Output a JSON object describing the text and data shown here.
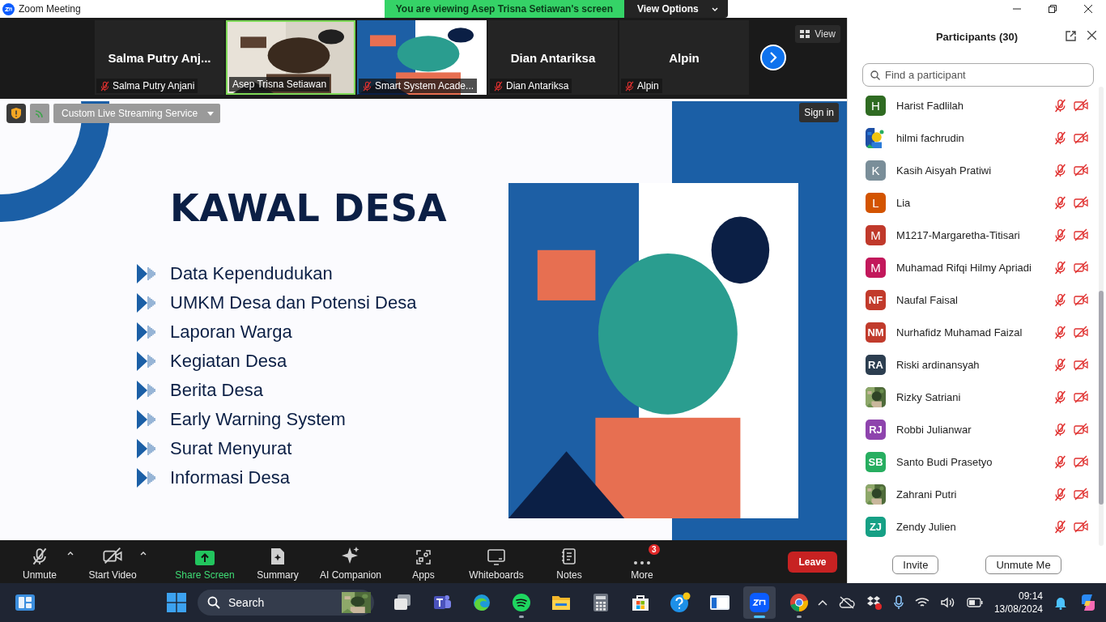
{
  "window": {
    "title": "Zoom Meeting"
  },
  "share_banner": {
    "text": "You are viewing Asep Trisna Setiawan's screen",
    "button": "View Options"
  },
  "video_strip": {
    "view_button": "View",
    "tiles": [
      {
        "kind": "name",
        "name": "Salma Putry Anj...",
        "label": "Salma Putry Anjani",
        "muted": true,
        "speaking": false
      },
      {
        "kind": "video",
        "label": "Asep Trisna Setiawan",
        "muted": false,
        "speaking": true
      },
      {
        "kind": "screen",
        "label": "Smart System Acade...",
        "muted": true,
        "speaking": false
      },
      {
        "kind": "name",
        "name": "Dian Antariksa",
        "label": "Dian Antariksa",
        "muted": true,
        "speaking": false
      },
      {
        "kind": "name",
        "name": "Alpin",
        "label": "Alpin",
        "muted": true,
        "speaking": false
      }
    ]
  },
  "share": {
    "stream_menu": "Custom Live Streaming Service",
    "sign_in": "Sign in",
    "slide": {
      "title": "KAWAL DESA",
      "bullets": [
        "Data Kependudukan",
        "UMKM Desa dan Potensi Desa",
        "Laporan Warga",
        "Kegiatan Desa",
        "Berita Desa",
        "Early Warning System",
        "Surat Menyurat",
        "Informasi Desa"
      ]
    }
  },
  "toolbar": {
    "items": [
      {
        "kind": "mic",
        "label": "Unmute",
        "caret": true
      },
      {
        "kind": "video",
        "label": "Start Video",
        "caret": true
      },
      {
        "kind": "share",
        "label": "Share Screen",
        "caret": false
      },
      {
        "kind": "summary",
        "label": "Summary",
        "caret": false
      },
      {
        "kind": "ai",
        "label": "AI Companion",
        "caret": false
      },
      {
        "kind": "apps",
        "label": "Apps",
        "caret": false
      },
      {
        "kind": "whiteboard",
        "label": "Whiteboards",
        "caret": false
      },
      {
        "kind": "notes",
        "label": "Notes",
        "caret": false
      },
      {
        "kind": "more",
        "label": "More",
        "caret": false,
        "badge": "3"
      }
    ],
    "leave": "Leave"
  },
  "participants": {
    "title": "Participants (30)",
    "search": {
      "placeholder": "Find a participant"
    },
    "rows": [
      {
        "name": "Harist Fadlilah",
        "avatar": {
          "kind": "initials",
          "text": "H",
          "color": "#2f6b22"
        },
        "muted": true,
        "video_off": true
      },
      {
        "name": "hilmi fachrudin",
        "muted": true,
        "video_off": true
      },
      {
        "name": "Kasih Aisyah Pratiwi",
        "avatar": {
          "kind": "initials",
          "text": "K",
          "color": "#7a8e99"
        },
        "muted": true,
        "video_off": true
      },
      {
        "name": "Lia",
        "avatar": {
          "kind": "initials",
          "text": "L",
          "color": "#d35400"
        },
        "muted": true,
        "video_off": true
      },
      {
        "name": "M1217-Margaretha-Titisari",
        "avatar": {
          "kind": "initials",
          "text": "M",
          "color": "#c0392b"
        },
        "muted": true,
        "video_off": true
      },
      {
        "name": "Muhamad Rifqi Hilmy Apriadi",
        "avatar": {
          "kind": "initials",
          "text": "M",
          "color": "#c2185b"
        },
        "muted": true,
        "video_off": true
      },
      {
        "name": "Naufal Faisal",
        "avatar": {
          "kind": "initials",
          "text": "NF",
          "color": "#c23a2b"
        },
        "muted": true,
        "video_off": true
      },
      {
        "name": "Nurhafidz Muhamad Faizal",
        "avatar": {
          "kind": "initials",
          "text": "NM",
          "color": "#c13b2c"
        },
        "muted": true,
        "video_off": true
      },
      {
        "name": "Riski ardinansyah",
        "avatar": {
          "kind": "initials",
          "text": "RA",
          "color": "#2c3e50"
        },
        "muted": true,
        "video_off": true
      },
      {
        "name": "Rizky Satriani",
        "muted": true,
        "video_off": true
      },
      {
        "name": "Robbi Julianwar",
        "avatar": {
          "kind": "initials",
          "text": "RJ",
          "color": "#8e44ad"
        },
        "muted": true,
        "video_off": true
      },
      {
        "name": "Santo Budi Prasetyo",
        "avatar": {
          "kind": "initials",
          "text": "SB",
          "color": "#27ae60"
        },
        "muted": true,
        "video_off": true
      },
      {
        "name": "Zahrani Putri",
        "muted": true,
        "video_off": true
      },
      {
        "name": "Zendy Julien",
        "avatar": {
          "kind": "initials",
          "text": "ZJ",
          "color": "#16a085"
        },
        "muted": true,
        "video_off": true
      }
    ],
    "buttons": [
      "Invite",
      "Unmute Me"
    ]
  },
  "taskbar": {
    "search": "Search",
    "apps": [
      {
        "kind": "taskview",
        "running": false,
        "selected": false
      },
      {
        "kind": "teams",
        "running": false,
        "selected": false
      },
      {
        "kind": "edge",
        "running": false,
        "selected": false
      },
      {
        "kind": "spotify",
        "running": true,
        "selected": false
      },
      {
        "kind": "files",
        "running": false,
        "selected": false
      },
      {
        "kind": "calculator",
        "running": false,
        "selected": false
      },
      {
        "kind": "store",
        "running": false,
        "selected": false
      },
      {
        "kind": "help",
        "running": false,
        "selected": false
      },
      {
        "kind": "window",
        "running": false,
        "selected": false
      },
      {
        "kind": "zoom",
        "running": true,
        "selected": true
      },
      {
        "kind": "chrome",
        "running": true,
        "selected": false
      }
    ],
    "time": "09:14",
    "date": "13/08/2024"
  }
}
